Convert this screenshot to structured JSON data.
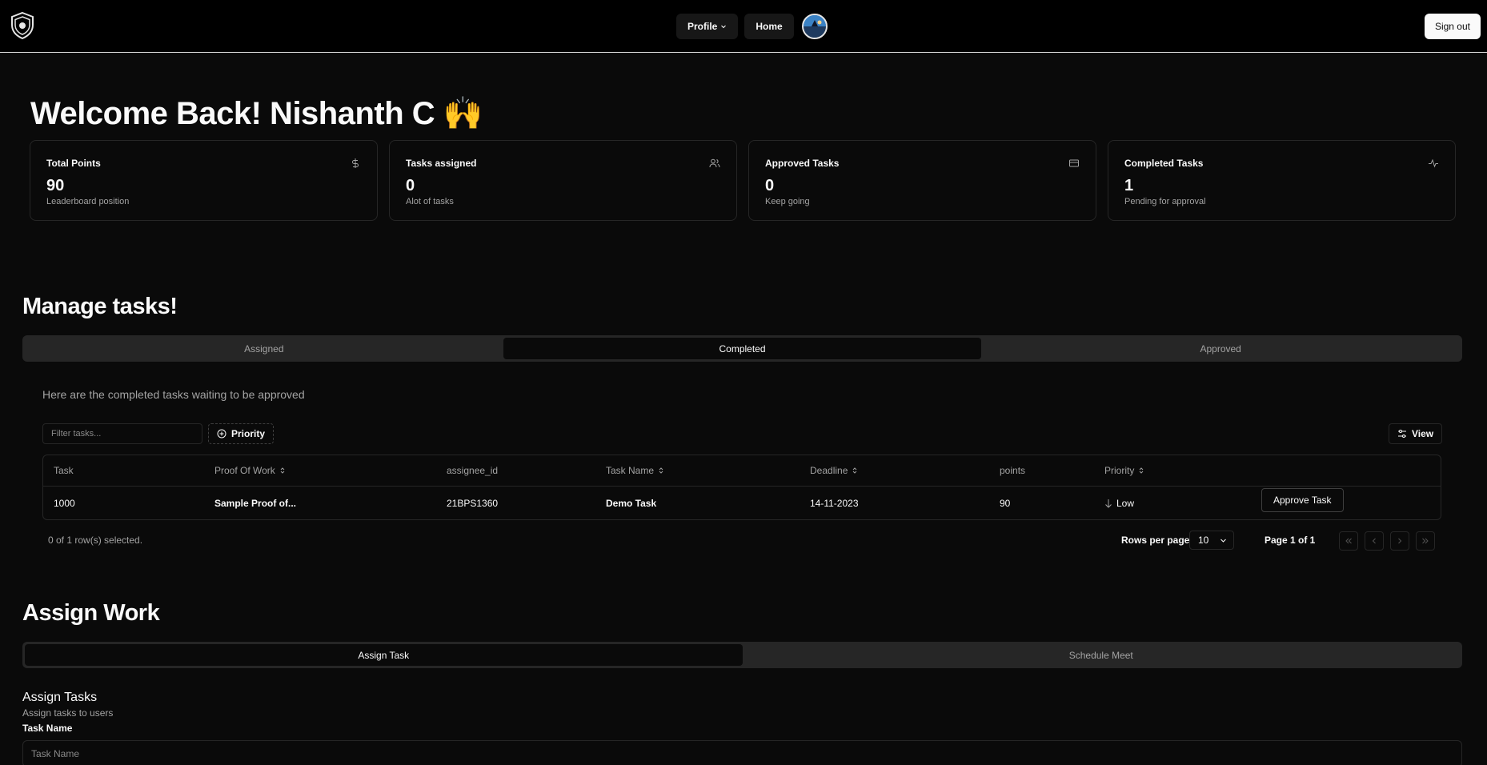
{
  "nav": {
    "profile_label": "Profile",
    "home_label": "Home",
    "signout_label": "Sign out"
  },
  "welcome": {
    "text": "Welcome Back! Nishanth C",
    "emoji": "🙌"
  },
  "stats": [
    {
      "title": "Total Points",
      "value": "90",
      "sub": "Leaderboard position",
      "icon": "dollar-icon"
    },
    {
      "title": "Tasks assigned",
      "value": "0",
      "sub": "Alot of tasks",
      "icon": "users-icon"
    },
    {
      "title": "Approved Tasks",
      "value": "0",
      "sub": "Keep going",
      "icon": "credit-card-icon"
    },
    {
      "title": "Completed Tasks",
      "value": "1",
      "sub": "Pending for approval",
      "icon": "activity-icon"
    }
  ],
  "manage": {
    "heading": "Manage tasks!",
    "tabs": [
      "Assigned",
      "Completed",
      "Approved"
    ],
    "active_tab": "Completed",
    "description": "Here are the completed tasks waiting to be approved",
    "filter_placeholder": "Filter tasks...",
    "priority_label": "Priority",
    "view_label": "View",
    "columns": [
      "Task",
      "Proof Of Work",
      "assignee_id",
      "Task Name",
      "Deadline",
      "points",
      "Priority"
    ],
    "rows": [
      {
        "task": "1000",
        "proof": "Sample Proof of...",
        "assignee": "21BPS1360",
        "name": "Demo Task",
        "deadline": "14-11-2023",
        "points": "90",
        "priority": "Low",
        "action": "Approve Task"
      }
    ],
    "selection": "0 of 1 row(s) selected.",
    "rows_per_page_label": "Rows per page",
    "rows_per_page": "10",
    "page_info": "Page 1 of 1"
  },
  "assign": {
    "heading": "Assign Work",
    "tabs": [
      "Assign Task",
      "Schedule Meet"
    ],
    "active_tab": "Assign Task",
    "section_title": "Assign Tasks",
    "section_sub": "Assign tasks to users",
    "field_label": "Task Name",
    "field_placeholder": "Task Name"
  },
  "colors": {
    "background": "#0a0a0a",
    "border": "#262626",
    "muted_text": "#a3a3a3",
    "foreground": "#fafafa"
  }
}
